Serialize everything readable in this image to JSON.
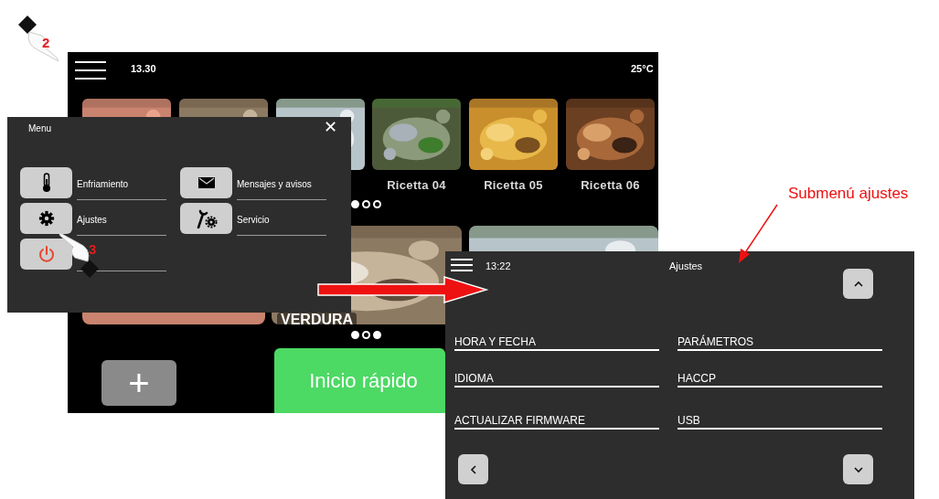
{
  "home_screen": {
    "time": "13.30",
    "temperature": "25°C",
    "recipes": [
      {
        "kind": "picture"
      },
      {
        "kind": "picture"
      },
      {
        "kind": "picture"
      },
      {
        "kind": "picture",
        "label": "Ricetta 04"
      },
      {
        "kind": "picture",
        "label": "Ricetta 05"
      },
      {
        "kind": "picture",
        "label": "Ricetta 06"
      }
    ],
    "recipe_pager": [
      {
        "selected": true
      },
      {
        "selected": false
      },
      {
        "selected": false
      }
    ],
    "categories": [
      {
        "kind": "picture"
      },
      {
        "kind": "picture",
        "label": "VERDURA"
      },
      {
        "kind": "picture"
      }
    ],
    "category_pager": [
      {
        "selected": true
      },
      {
        "selected": false
      },
      {
        "selected": true
      }
    ],
    "add_button": "+",
    "quick_start_button": "Inicio rápido"
  },
  "menu": {
    "title": "Menu",
    "close": "✕",
    "items": [
      {
        "kind": "thermometer",
        "label": "Enfriamiento"
      },
      {
        "kind": "gear",
        "label": "Ajustes"
      },
      {
        "kind": "power"
      },
      {
        "kind": "envelope",
        "label": "Mensajes y avisos"
      },
      {
        "kind": "wrench",
        "label": "Servicio"
      }
    ]
  },
  "settings_screen": {
    "time": "13:22",
    "title": "Ajustes",
    "items": [
      {
        "label": "HORA Y FECHA"
      },
      {
        "label": "PARÁMETROS"
      },
      {
        "label": "IDIOMA"
      },
      {
        "label": "HACCP"
      },
      {
        "label": "ACTUALIZAR FIRMWARE"
      },
      {
        "label": "USB"
      }
    ]
  },
  "steps": [
    "2",
    "3"
  ],
  "annotation": "Submenú ajustes"
}
